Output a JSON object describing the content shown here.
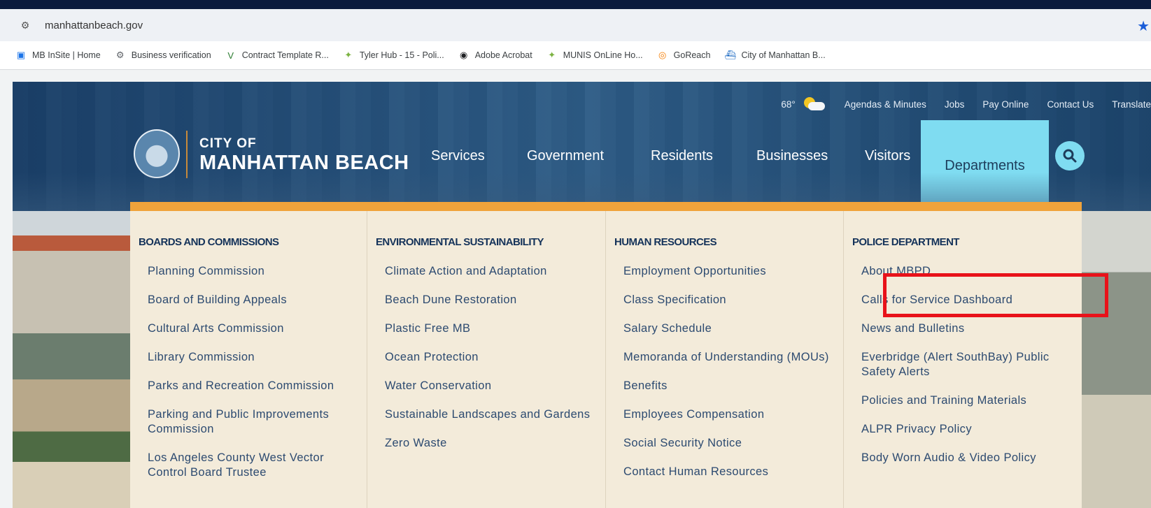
{
  "browser": {
    "url": "manhattanbeach.gov",
    "bookmarks": [
      {
        "label": "MB InSite | Home",
        "icon": "window-icon",
        "color": "#1a73e8"
      },
      {
        "label": "Business verification",
        "icon": "gear-icon",
        "color": "#5f6368"
      },
      {
        "label": "Contract Template R...",
        "icon": "vee-icon",
        "color": "#2e7d32"
      },
      {
        "label": "Tyler Hub - 15 - Poli...",
        "icon": "tyler-icon",
        "color": "#7cb342"
      },
      {
        "label": "Adobe Acrobat",
        "icon": "globe-icon",
        "color": "#202124"
      },
      {
        "label": "MUNIS OnLine Ho...",
        "icon": "tyler-icon",
        "color": "#7cb342"
      },
      {
        "label": "GoReach",
        "icon": "pin-icon",
        "color": "#f57c00"
      },
      {
        "label": "City of Manhattan B...",
        "icon": "city-icon",
        "color": "#1565c0"
      }
    ]
  },
  "site": {
    "utility": {
      "temperature": "68°",
      "links": [
        "Agendas & Minutes",
        "Jobs",
        "Pay Online",
        "Contact Us",
        "Translate"
      ]
    },
    "brand": {
      "top": "CITY OF",
      "main": "MANHATTAN BEACH"
    },
    "nav": {
      "items": [
        "Services",
        "Government",
        "Residents",
        "Businesses",
        "Visitors"
      ],
      "active": "Departments"
    },
    "columns": [
      {
        "heading": "BOARDS AND COMMISSIONS",
        "links": [
          "Planning Commission",
          "Board of Building Appeals",
          "Cultural Arts Commission",
          "Library Commission",
          "Parks and Recreation Commission",
          "Parking and Public Improvements Commission",
          "Los Angeles County West Vector Control Board Trustee"
        ]
      },
      {
        "heading": "ENVIRONMENTAL SUSTAINABILITY",
        "links": [
          "Climate Action and Adaptation",
          "Beach Dune Restoration",
          "Plastic Free MB",
          "Ocean Protection",
          "Water Conservation",
          "Sustainable Landscapes and Gardens",
          "Zero Waste"
        ]
      },
      {
        "heading": "HUMAN RESOURCES",
        "links": [
          "Employment Opportunities",
          "Class Specification",
          "Salary Schedule",
          "Memoranda of Understanding (MOUs)",
          "Benefits",
          "Employees Compensation",
          "Social Security Notice",
          "Contact Human Resources"
        ]
      },
      {
        "heading": "POLICE DEPARTMENT",
        "links": [
          "About MBPD",
          "Calls for Service Dashboard",
          "News and Bulletins",
          "Everbridge (Alert SouthBay) Public Safety Alerts",
          "Policies and Training Materials",
          "ALPR Privacy Policy",
          "Body Worn Audio & Video Policy"
        ]
      }
    ]
  },
  "colors": {
    "accent": "#f0a33b",
    "active_nav": "#7fdcf1",
    "highlight": "#e8121a"
  }
}
